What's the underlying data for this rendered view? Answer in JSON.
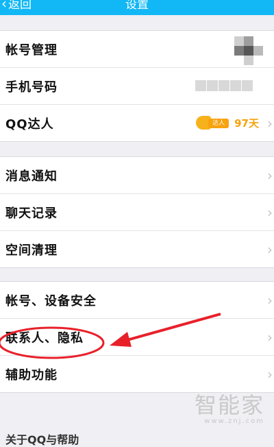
{
  "navbar": {
    "back_label": "返回",
    "title": "设置"
  },
  "group1": [
    {
      "label": "帐号管理"
    },
    {
      "label": "手机号码"
    },
    {
      "label": "QQ达人",
      "badge_text": "达人",
      "days": "97天"
    }
  ],
  "group2": [
    {
      "label": "消息通知"
    },
    {
      "label": "聊天记录"
    },
    {
      "label": "空间清理"
    }
  ],
  "group3": [
    {
      "label": "帐号、设备安全"
    },
    {
      "label": "联系人、隐私"
    },
    {
      "label": "辅助功能"
    }
  ],
  "bottom_row": {
    "label": "关于QQ与帮助"
  },
  "watermark": {
    "brand": "智能家",
    "url": "www.znj.com"
  },
  "colors": {
    "navbar": "#12b7f5",
    "annotation": "#e8202a",
    "badge": "#f7a20f"
  },
  "icons": {
    "back": "chevron-left-icon",
    "row_arrow": "chevron-right-icon"
  }
}
